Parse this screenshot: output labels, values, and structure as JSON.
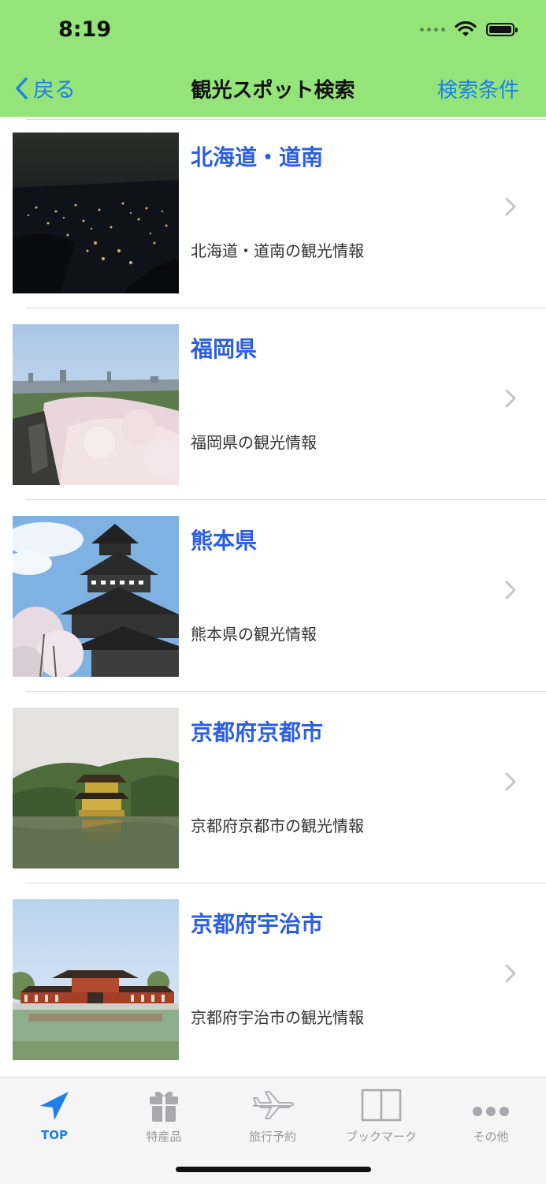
{
  "status": {
    "time": "8:19"
  },
  "nav": {
    "back_label": "戻る",
    "title": "観光スポット検索",
    "right_label": "検索条件"
  },
  "spots": [
    {
      "title": "北海道・道南",
      "subtitle": "北海道・道南の観光情報",
      "image": "night city view"
    },
    {
      "title": "福岡県",
      "subtitle": "福岡県の観光情報",
      "image": "cherry blossoms over city"
    },
    {
      "title": "熊本県",
      "subtitle": "熊本県の観光情報",
      "image": "castle with cherry blossoms"
    },
    {
      "title": "京都府京都市",
      "subtitle": "京都府京都市の観光情報",
      "image": "golden pavilion"
    },
    {
      "title": "京都府宇治市",
      "subtitle": "京都府宇治市の観光情報",
      "image": "phoenix hall"
    }
  ],
  "tabbar": {
    "items": [
      {
        "label": "TOP",
        "icon": "location-arrow-icon",
        "active": true
      },
      {
        "label": "特産品",
        "icon": "gift-icon",
        "active": false
      },
      {
        "label": "旅行予約",
        "icon": "airplane-icon",
        "active": false
      },
      {
        "label": "ブックマーク",
        "icon": "book-icon",
        "active": false
      },
      {
        "label": "その他",
        "icon": "more-icon",
        "active": false
      }
    ]
  },
  "colors": {
    "header_bg": "#95e47a",
    "accent": "#1d7fe8",
    "title_blue": "#2c5ee0"
  }
}
